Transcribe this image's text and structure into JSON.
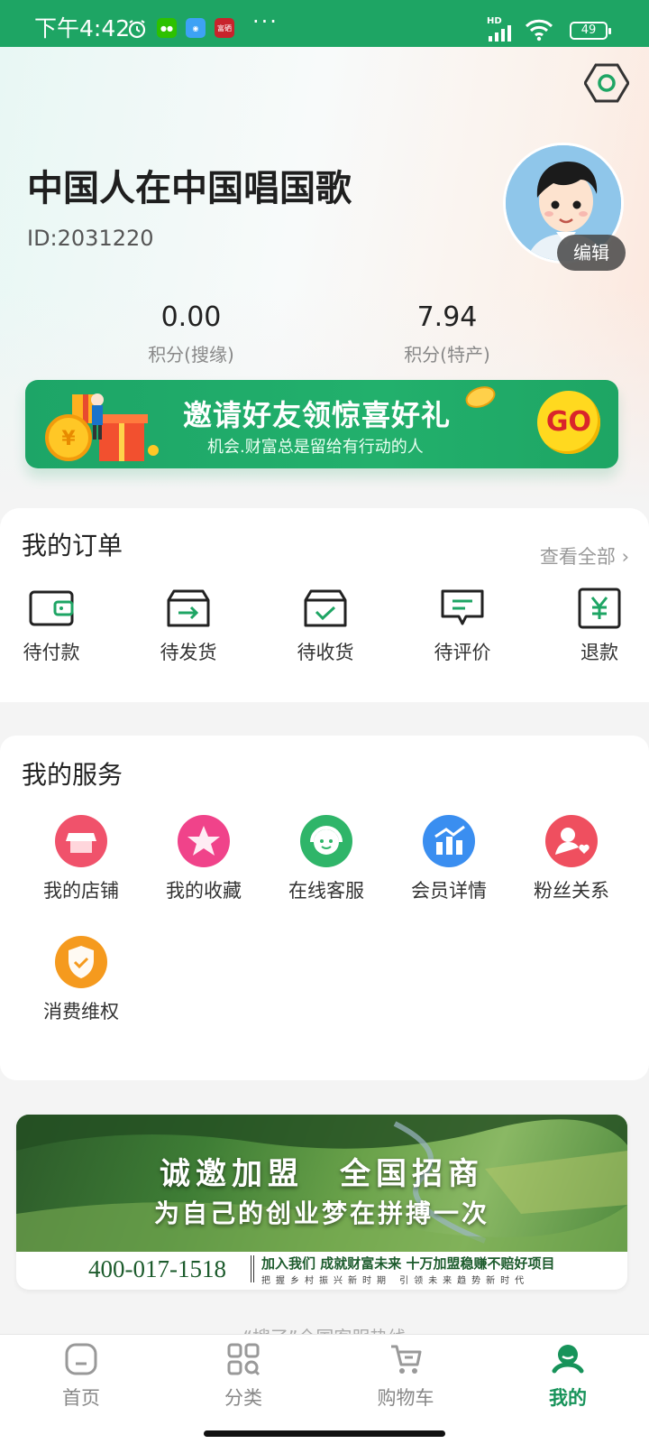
{
  "status_bar": {
    "time": "下午4:42",
    "network": "HD",
    "battery": "49",
    "more": "···",
    "app_icon_text": "富硒"
  },
  "profile": {
    "name": "中国人在中国唱国歌",
    "id_text": "ID:2031220",
    "edit_label": "编辑",
    "stats": [
      {
        "value": "0.00",
        "label": "积分(搜缘)"
      },
      {
        "value": "7.94",
        "label": "积分(特产)"
      }
    ]
  },
  "invite_banner": {
    "title": "邀请好友领惊喜好礼",
    "subtitle": "机会.财富总是留给有行动的人",
    "go_label": "GO"
  },
  "orders": {
    "title": "我的订单",
    "view_all": "查看全部",
    "items": [
      {
        "label": "待付款",
        "icon": "wallet-icon"
      },
      {
        "label": "待发货",
        "icon": "box-arrow-icon"
      },
      {
        "label": "待收货",
        "icon": "box-check-icon"
      },
      {
        "label": "待评价",
        "icon": "comment-icon"
      },
      {
        "label": "退款",
        "icon": "yen-icon"
      }
    ]
  },
  "services": {
    "title": "我的服务",
    "items": [
      {
        "label": "我的店铺",
        "icon": "store-icon",
        "color": "#f0526b"
      },
      {
        "label": "我的收藏",
        "icon": "star-icon",
        "color": "#f0438a"
      },
      {
        "label": "在线客服",
        "icon": "headset-icon",
        "color": "#2fb569"
      },
      {
        "label": "会员详情",
        "icon": "chart-icon",
        "color": "#3a8ef0"
      },
      {
        "label": "粉丝关系",
        "icon": "fans-icon",
        "color": "#ef4f5f"
      },
      {
        "label": "消费维权",
        "icon": "shield-icon",
        "color": "#f59a1e"
      }
    ]
  },
  "promo_banner": {
    "headline": "诚邀加盟　全国招商",
    "subheadline": "为自己的创业梦在拼搏一次",
    "phone": "400-017-1518",
    "slogan": "加入我们 成就财富未来 十万加盟稳赚不赔好项目",
    "slogan_small": "把握乡村振兴新时期 引领未来趋势新时代"
  },
  "footer_tip": "“搜了”全国客服热线",
  "tabbar": {
    "items": [
      {
        "label": "首页",
        "icon": "home-icon"
      },
      {
        "label": "分类",
        "icon": "category-icon"
      },
      {
        "label": "购物车",
        "icon": "cart-icon"
      },
      {
        "label": "我的",
        "icon": "profile-icon"
      }
    ],
    "active": "我的"
  },
  "colors": {
    "brand_green": "#1ea564",
    "active_tab": "#17935a"
  }
}
